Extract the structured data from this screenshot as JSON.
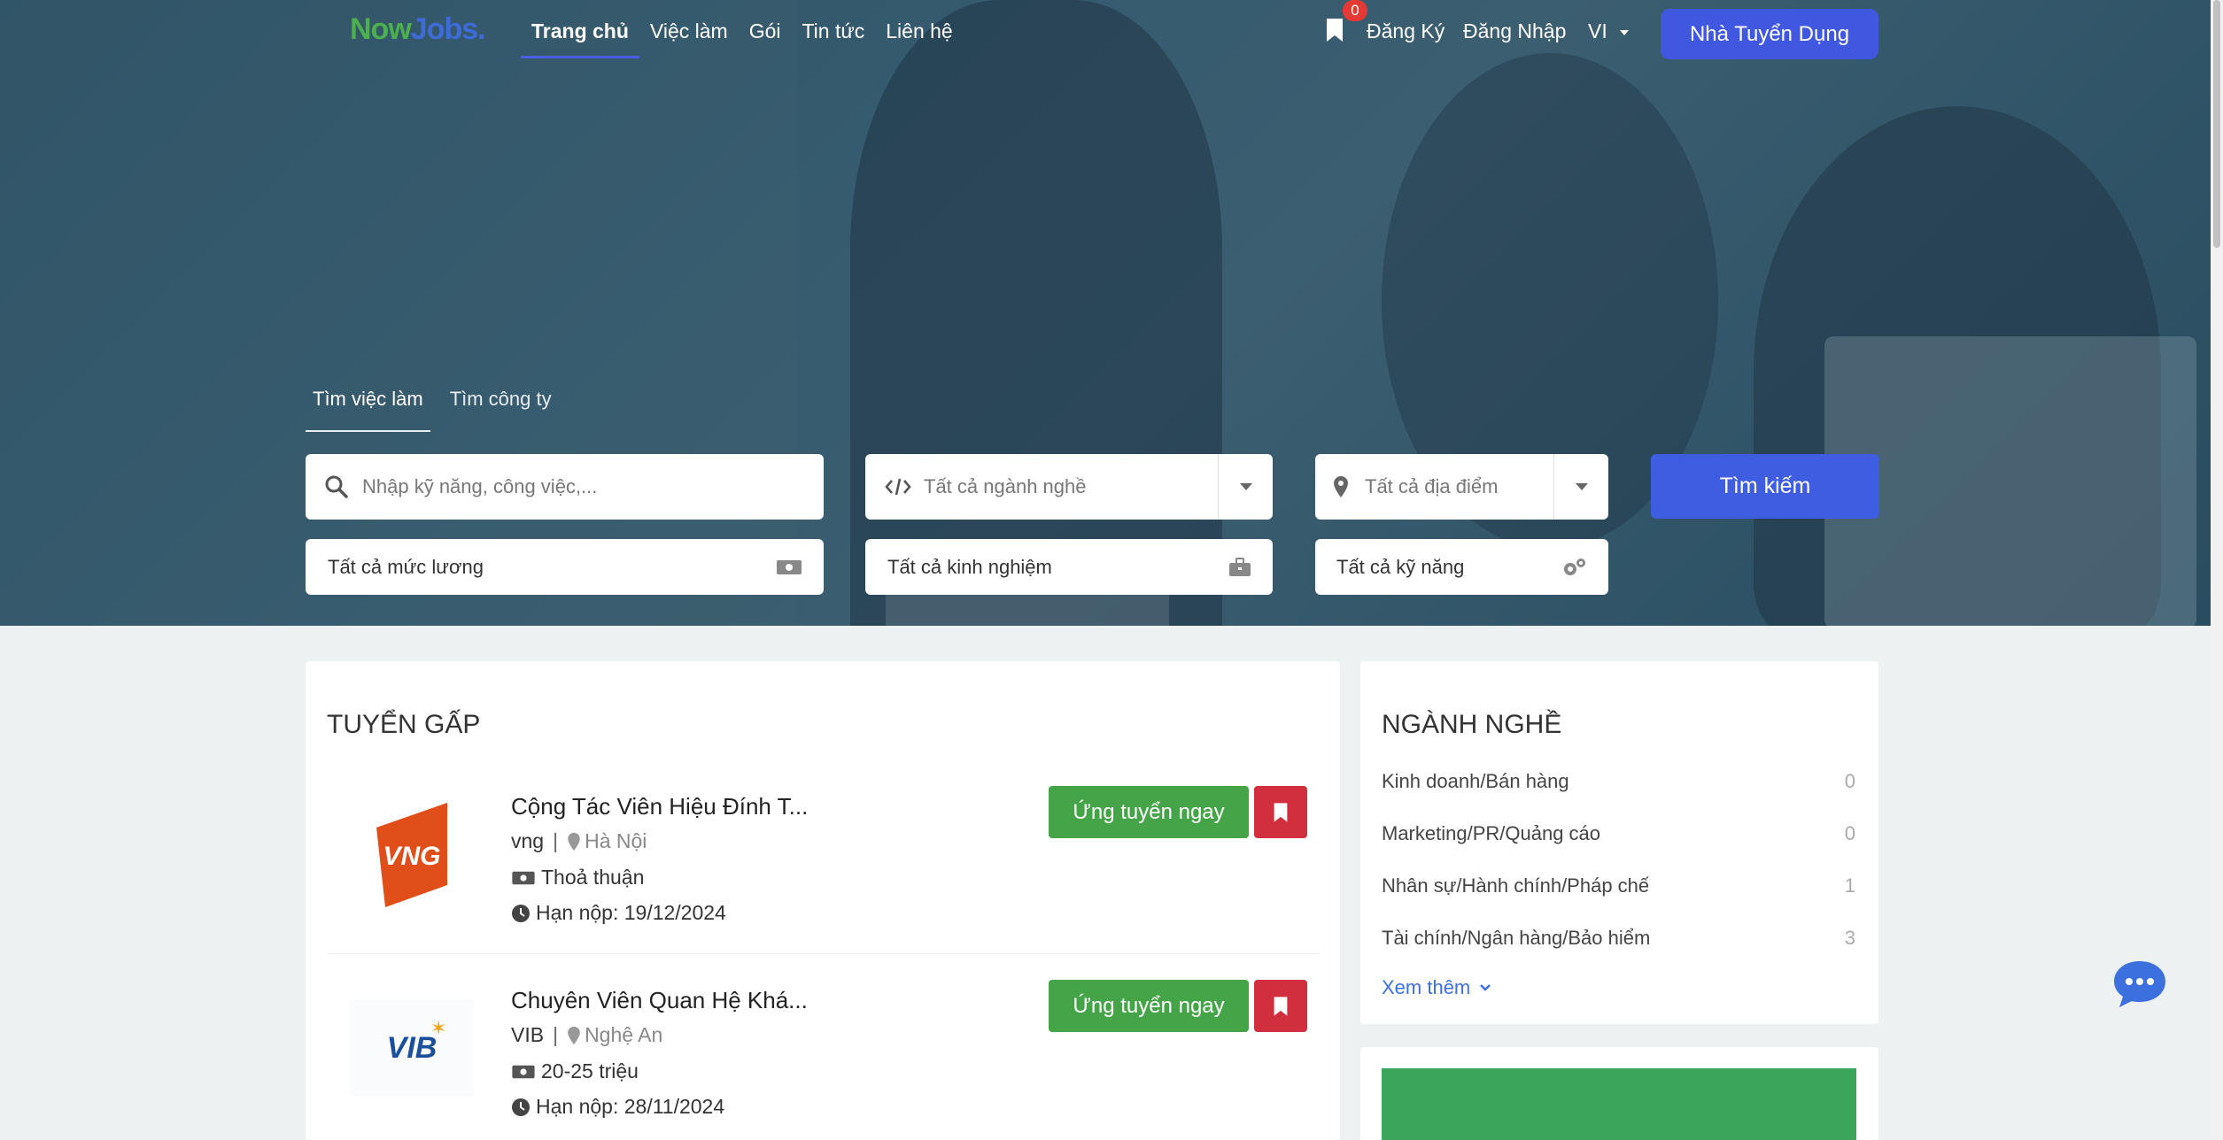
{
  "nav": {
    "logo_part1": "Now",
    "logo_part2": "Jobs.",
    "links": [
      "Trang chủ",
      "Việc làm",
      "Gói",
      "Tin tức",
      "Liên hệ"
    ],
    "bookmark_count": "0",
    "register": "Đăng Ký",
    "login": "Đăng Nhập",
    "language": "VI",
    "employer_button": "Nhà Tuyển Dụng"
  },
  "search": {
    "tabs": [
      "Tìm việc làm",
      "Tìm công ty"
    ],
    "keyword_placeholder": "Nhập kỹ năng, công việc,...",
    "industry": "Tất cả ngành nghề",
    "location": "Tất cả địa điểm",
    "salary": "Tất cả mức lương",
    "experience": "Tất cả kinh nghiệm",
    "skills": "Tất cả kỹ năng",
    "search_button": "Tìm kiếm"
  },
  "urgent": {
    "title": "TUYỂN GẤP",
    "apply_label": "Ứng tuyển ngay",
    "jobs": [
      {
        "title": "Cộng Tác Viên Hiệu Đính T...",
        "company": "vng",
        "location": "Hà Nội",
        "salary": "Thoả thuận",
        "deadline": "Hạn nộp: 19/12/2024",
        "logo_text": "VNG"
      },
      {
        "title": "Chuyên Viên Quan Hệ Khá...",
        "company": "VIB",
        "location": "Nghệ An",
        "salary": "20-25 triệu",
        "deadline": "Hạn nộp: 28/11/2024",
        "logo_text": "VIB"
      }
    ]
  },
  "industries": {
    "title": "NGÀNH NGHỀ",
    "items": [
      {
        "name": "Kinh doanh/Bán hàng",
        "count": "0"
      },
      {
        "name": "Marketing/PR/Quảng cáo",
        "count": "0"
      },
      {
        "name": "Nhân sự/Hành chính/Pháp chế",
        "count": "1"
      },
      {
        "name": "Tài chính/Ngân hàng/Bảo hiểm",
        "count": "3"
      }
    ],
    "see_more": "Xem thêm"
  },
  "colors": {
    "primary": "#3f5de0",
    "apply_green": "#45a447",
    "save_red": "#d12f3d",
    "logo_green": "#4caf50"
  }
}
